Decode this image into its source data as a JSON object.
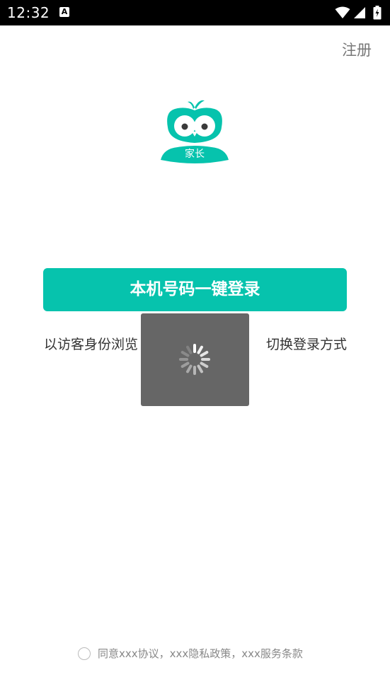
{
  "status_bar": {
    "time": "12:32",
    "notification_icon": "A"
  },
  "header": {
    "register_label": "注册"
  },
  "logo": {
    "caption": "家长",
    "icon": "owl-logo-icon"
  },
  "actions": {
    "one_click_login_label": "本机号码一键登录",
    "guest_browse_label": "以访客身份浏览",
    "switch_login_label": "切换登录方式"
  },
  "agreement": {
    "text": "同意xxx协议，xxx隐私政策，xxx服务条款"
  },
  "colors": {
    "accent": "#06c3ad",
    "overlay": "#666666",
    "status_bar": "#000000"
  }
}
